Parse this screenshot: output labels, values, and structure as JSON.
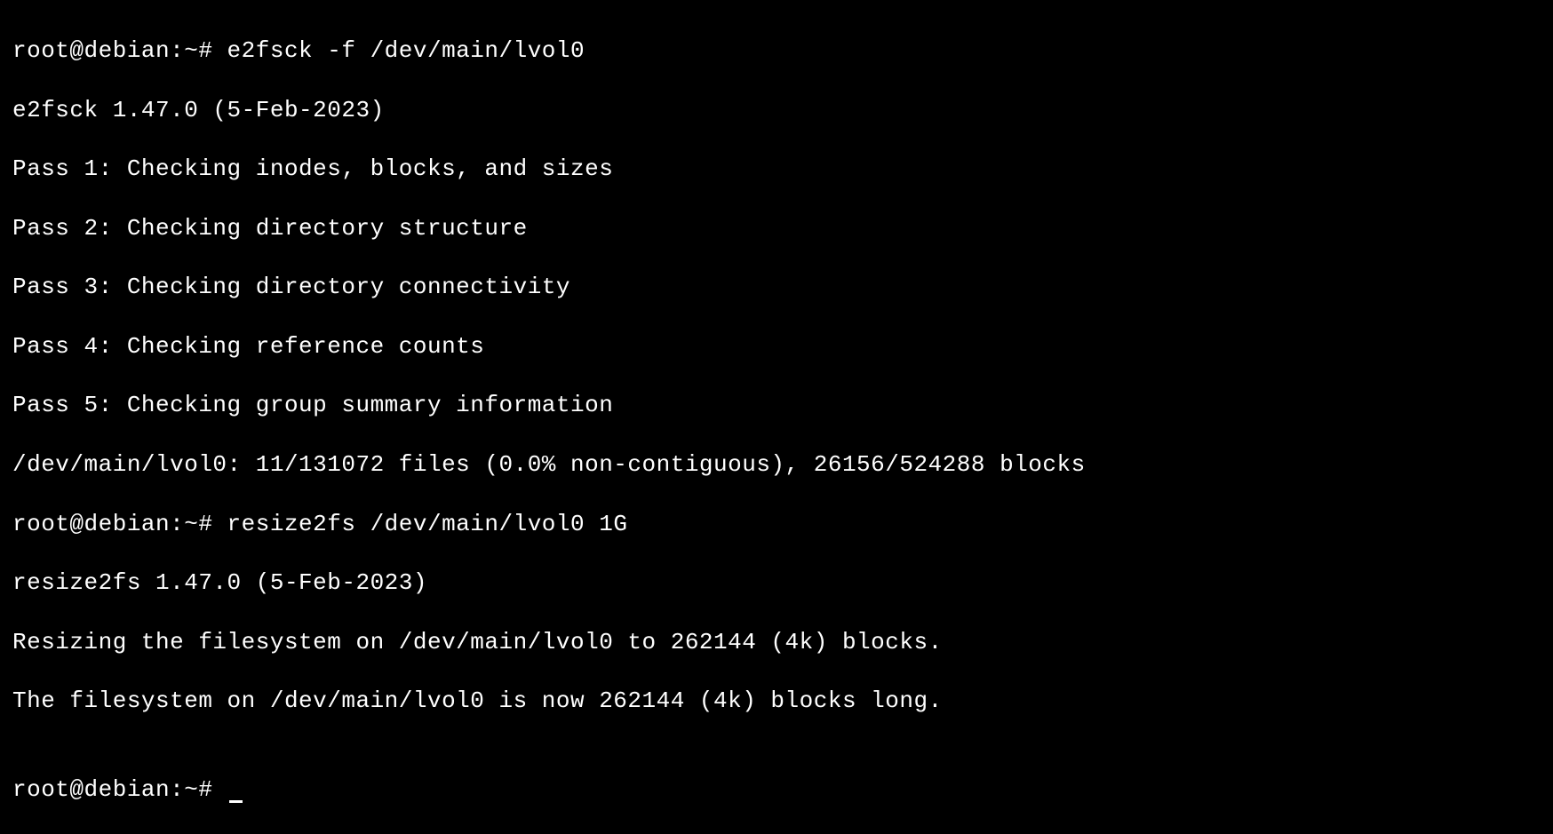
{
  "terminal": {
    "prompt1": "root@debian:~# ",
    "command1": "e2fsck -f /dev/main/lvol0",
    "output1_line1": "e2fsck 1.47.0 (5-Feb-2023)",
    "output1_line2": "Pass 1: Checking inodes, blocks, and sizes",
    "output1_line3": "Pass 2: Checking directory structure",
    "output1_line4": "Pass 3: Checking directory connectivity",
    "output1_line5": "Pass 4: Checking reference counts",
    "output1_line6": "Pass 5: Checking group summary information",
    "output1_line7": "/dev/main/lvol0: 11/131072 files (0.0% non-contiguous), 26156/524288 blocks",
    "prompt2": "root@debian:~# ",
    "command2": "resize2fs /dev/main/lvol0 1G",
    "output2_line1": "resize2fs 1.47.0 (5-Feb-2023)",
    "output2_line2": "Resizing the filesystem on /dev/main/lvol0 to 262144 (4k) blocks.",
    "output2_line3": "The filesystem on /dev/main/lvol0 is now 262144 (4k) blocks long.",
    "blank": "",
    "prompt3": "root@debian:~# "
  }
}
